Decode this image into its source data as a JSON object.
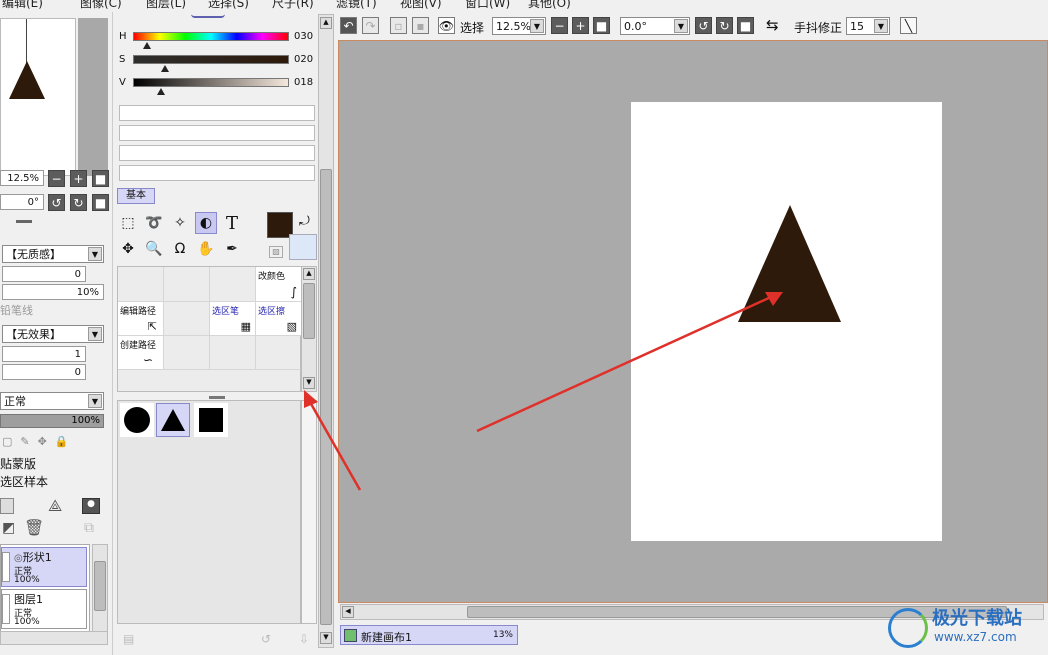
{
  "menu": [
    "编辑(E)",
    "图像(C)",
    "图层(L)",
    "选择(S)",
    "尺子(R)",
    "滤镜(T)",
    "视图(V)",
    "窗口(W)",
    "其他(O)"
  ],
  "navigator": {
    "zoom": "12.5%",
    "angle": "0°"
  },
  "color_sliders": [
    {
      "label": "H",
      "value": "030"
    },
    {
      "label": "S",
      "value": "020"
    },
    {
      "label": "V",
      "value": "018"
    }
  ],
  "tool_tab": "基本",
  "brush": {
    "texture": "【无质感】",
    "texture_val": "0",
    "texture_pct": "10%",
    "pen_label": "铅笔线",
    "effect": "【无效果】",
    "effect_val1": "1",
    "effect_val2": "0"
  },
  "layer_props": {
    "blend_mode": "正常",
    "opacity": "100%",
    "clip_label": "贴蒙版",
    "select_source_label": "选区样本"
  },
  "subtools": [
    {
      "label": "改颜色"
    },
    {
      "label": "编辑路径"
    },
    {
      "label": "选区笔"
    },
    {
      "label": "选区擦"
    },
    {
      "label": "创建路径"
    }
  ],
  "shapes": [
    "circle",
    "triangle",
    "square"
  ],
  "layers": [
    {
      "name": "形状1",
      "mode": "正常",
      "opacity": "100%"
    },
    {
      "name": "图层1",
      "mode": "正常",
      "opacity": "100%"
    }
  ],
  "toolbar": {
    "selection_label": "选择",
    "zoom": "12.5%",
    "rotation": "0.0°",
    "stabilizer_label": "手抖修正",
    "stabilizer_value": "15"
  },
  "canvas_tab": {
    "name": "新建画布1",
    "zoom": "13%"
  },
  "colors": {
    "main": "#2e1a0a",
    "canvas_bg": "#aaaaaa",
    "paper": "#ffffff",
    "arrow": "#e0302a"
  },
  "watermark": {
    "text": "极光下载站",
    "url": "www.xz7.com"
  }
}
